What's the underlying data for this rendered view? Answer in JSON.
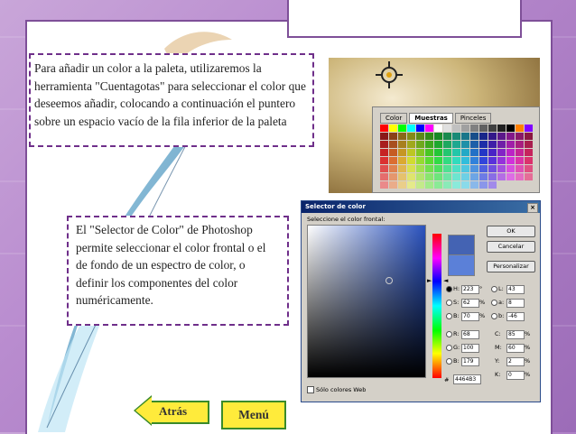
{
  "slide": {
    "paragraph_palette": "Para añadir un color a la paleta, utilizaremos la herramienta \"Cuentagotas\" para seleccionar el color que deseemos añadir, colocando a continuación el puntero sobre un espacio vacío de la fila inferior de la paleta",
    "paragraph_picker": "El \"Selector de Color\" de Photoshop permite seleccionar el color frontal o el de fondo de un espectro de color, o definir los componentes del color numéricamente."
  },
  "palette_window": {
    "tabs": [
      "Color",
      "Muestras",
      "Pinceles"
    ],
    "active_tab": "Muestras"
  },
  "color_dialog": {
    "title": "Selector de color",
    "field_label": "Seleccione el color frontal:",
    "buttons": {
      "ok": "OK",
      "cancel": "Cancelar",
      "custom": "Personalizar"
    },
    "hsb": [
      {
        "label": "H:",
        "value": "223",
        "unit": "°"
      },
      {
        "label": "S:",
        "value": "62",
        "unit": "%"
      },
      {
        "label": "B:",
        "value": "70",
        "unit": "%"
      }
    ],
    "rgb": [
      {
        "label": "R:",
        "value": "68"
      },
      {
        "label": "G:",
        "value": "100"
      },
      {
        "label": "B:",
        "value": "179"
      }
    ],
    "lab": [
      {
        "label": "L:",
        "value": "43"
      },
      {
        "label": "a:",
        "value": "8"
      },
      {
        "label": "b:",
        "value": "-46"
      }
    ],
    "cmyk": [
      {
        "label": "C:",
        "value": "85",
        "unit": "%"
      },
      {
        "label": "M:",
        "value": "60",
        "unit": "%"
      },
      {
        "label": "Y:",
        "value": "2",
        "unit": "%"
      },
      {
        "label": "K:",
        "value": "0",
        "unit": "%"
      }
    ],
    "hex_label": "#",
    "hex": "4464B3",
    "web_only": "Sólo colores Web",
    "new_color": "#4463b3",
    "current_color": "#5b80d8"
  },
  "nav": {
    "back": "Atrás",
    "menu": "Menú"
  },
  "colors": {
    "frame": "#7e4f98",
    "text_border": "#6f2f8a",
    "button_fill": "#ffeb3b",
    "button_border": "#3a8a2a"
  }
}
